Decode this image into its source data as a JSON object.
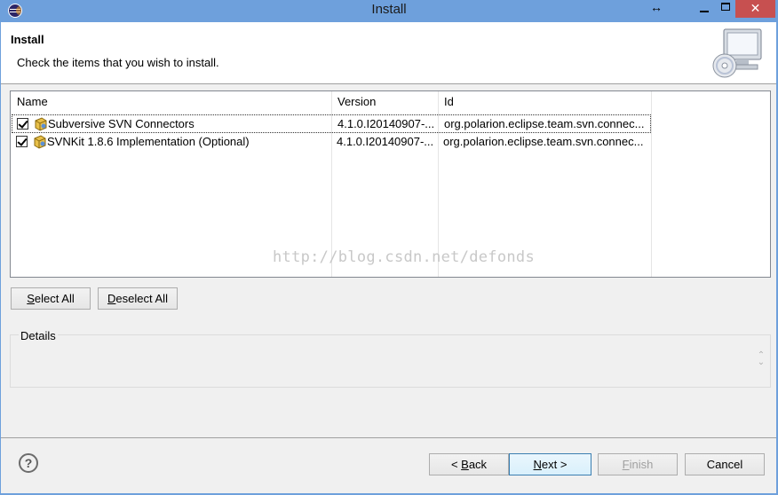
{
  "window": {
    "title": "Install",
    "controls": {
      "resize": "↔",
      "minimize": "",
      "maximize": "",
      "close": "✕"
    }
  },
  "banner": {
    "title": "Install",
    "description": "Check the items that you wish to install."
  },
  "table": {
    "columns": [
      "Name",
      "Version",
      "Id"
    ],
    "rows": [
      {
        "checked": true,
        "name": "Subversive SVN Connectors",
        "version": "4.1.0.I20140907-...",
        "id": "org.polarion.eclipse.team.svn.connec..."
      },
      {
        "checked": true,
        "name": "SVNKit 1.8.6 Implementation (Optional)",
        "version": "4.1.0.I20140907-...",
        "id": "org.polarion.eclipse.team.svn.connec..."
      }
    ]
  },
  "watermark": "http://blog.csdn.net/defonds",
  "buttons": {
    "select_all": {
      "accel": "S",
      "rest": "elect All"
    },
    "deselect_all": {
      "accel": "D",
      "rest": "eselect All"
    },
    "back": {
      "pre": "< ",
      "accel": "B",
      "rest": "ack"
    },
    "next": {
      "accel": "N",
      "rest": "ext >"
    },
    "finish": {
      "accel": "F",
      "rest": "inish"
    },
    "cancel": "Cancel"
  },
  "details": {
    "label": "Details"
  },
  "help": "?",
  "icons": {
    "app": "eclipse-icon",
    "banner": "install-computer-icon",
    "feature": "feature-plugin-icon",
    "help": "help-icon"
  }
}
